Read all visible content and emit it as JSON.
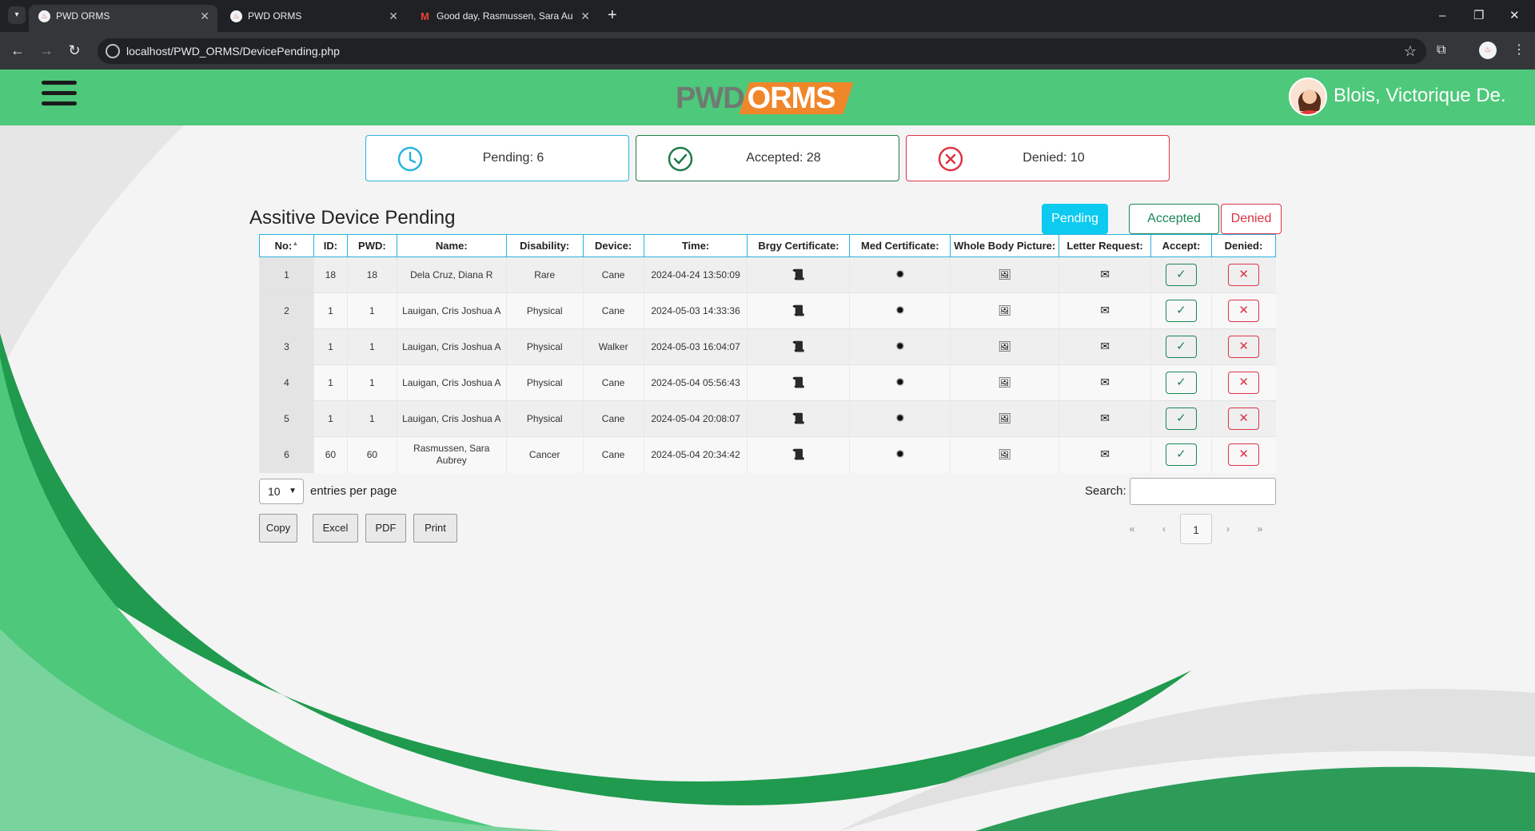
{
  "browser": {
    "tabs": [
      {
        "title": "PWD ORMS",
        "active": true
      },
      {
        "title": "PWD ORMS",
        "active": false
      },
      {
        "title": "Good day, Rasmussen, Sara Au",
        "active": false
      }
    ],
    "url": "localhost/PWD_ORMS/DevicePending.php"
  },
  "header": {
    "logo_left": "PWD",
    "logo_right": "ORMS",
    "user_name": "Blois, Victorique De.",
    "accent": "#4ec87a",
    "logo_accent": "#f0862a"
  },
  "stats": {
    "pending": "Pending: 6",
    "accepted": "Accepted: 28",
    "denied": "Denied: 10"
  },
  "section_title": "Assitive Device Pending",
  "filters": {
    "pending": "Pending",
    "accepted": "Accepted",
    "denied": "Denied"
  },
  "table": {
    "headers": [
      "No:",
      "ID:",
      "PWD:",
      "Name:",
      "Disability:",
      "Device:",
      "Time:",
      "Brgy Certificate:",
      "Med Certificate:",
      "Whole Body Picture:",
      "Letter Request:",
      "Accept:",
      "Denied:"
    ],
    "rows": [
      {
        "no": "1",
        "id": "18",
        "pwd": "18",
        "name": "Dela Cruz, Diana R",
        "disability": "Rare",
        "device": "Cane",
        "time": "2024-04-24 13:50:09"
      },
      {
        "no": "2",
        "id": "1",
        "pwd": "1",
        "name": "Lauigan, Cris Joshua A",
        "disability": "Physical",
        "device": "Cane",
        "time": "2024-05-03 14:33:36"
      },
      {
        "no": "3",
        "id": "1",
        "pwd": "1",
        "name": "Lauigan, Cris Joshua A",
        "disability": "Physical",
        "device": "Walker",
        "time": "2024-05-03 16:04:07"
      },
      {
        "no": "4",
        "id": "1",
        "pwd": "1",
        "name": "Lauigan, Cris Joshua A",
        "disability": "Physical",
        "device": "Cane",
        "time": "2024-05-04 05:56:43"
      },
      {
        "no": "5",
        "id": "1",
        "pwd": "1",
        "name": "Lauigan, Cris Joshua A",
        "disability": "Physical",
        "device": "Cane",
        "time": "2024-05-04 20:08:07"
      },
      {
        "no": "6",
        "id": "60",
        "pwd": "60",
        "name": "Rasmussen, Sara Aubrey",
        "disability": "Cancer",
        "device": "Cane",
        "time": "2024-05-04 20:34:42"
      }
    ],
    "icons": {
      "brgy": "scroll-icon",
      "med": "certificate-icon",
      "picture": "image-icon",
      "letter": "envelope-icon",
      "accept": "check-icon",
      "deny": "x-icon"
    }
  },
  "controls": {
    "page_length": "10",
    "entries_label": "entries per page",
    "search_label": "Search:",
    "search_value": "",
    "export_buttons": [
      "Copy",
      "Excel",
      "PDF",
      "Print"
    ],
    "pagination": {
      "first": "«",
      "prev": "‹",
      "current": "1",
      "next": "›",
      "last": "»"
    }
  }
}
